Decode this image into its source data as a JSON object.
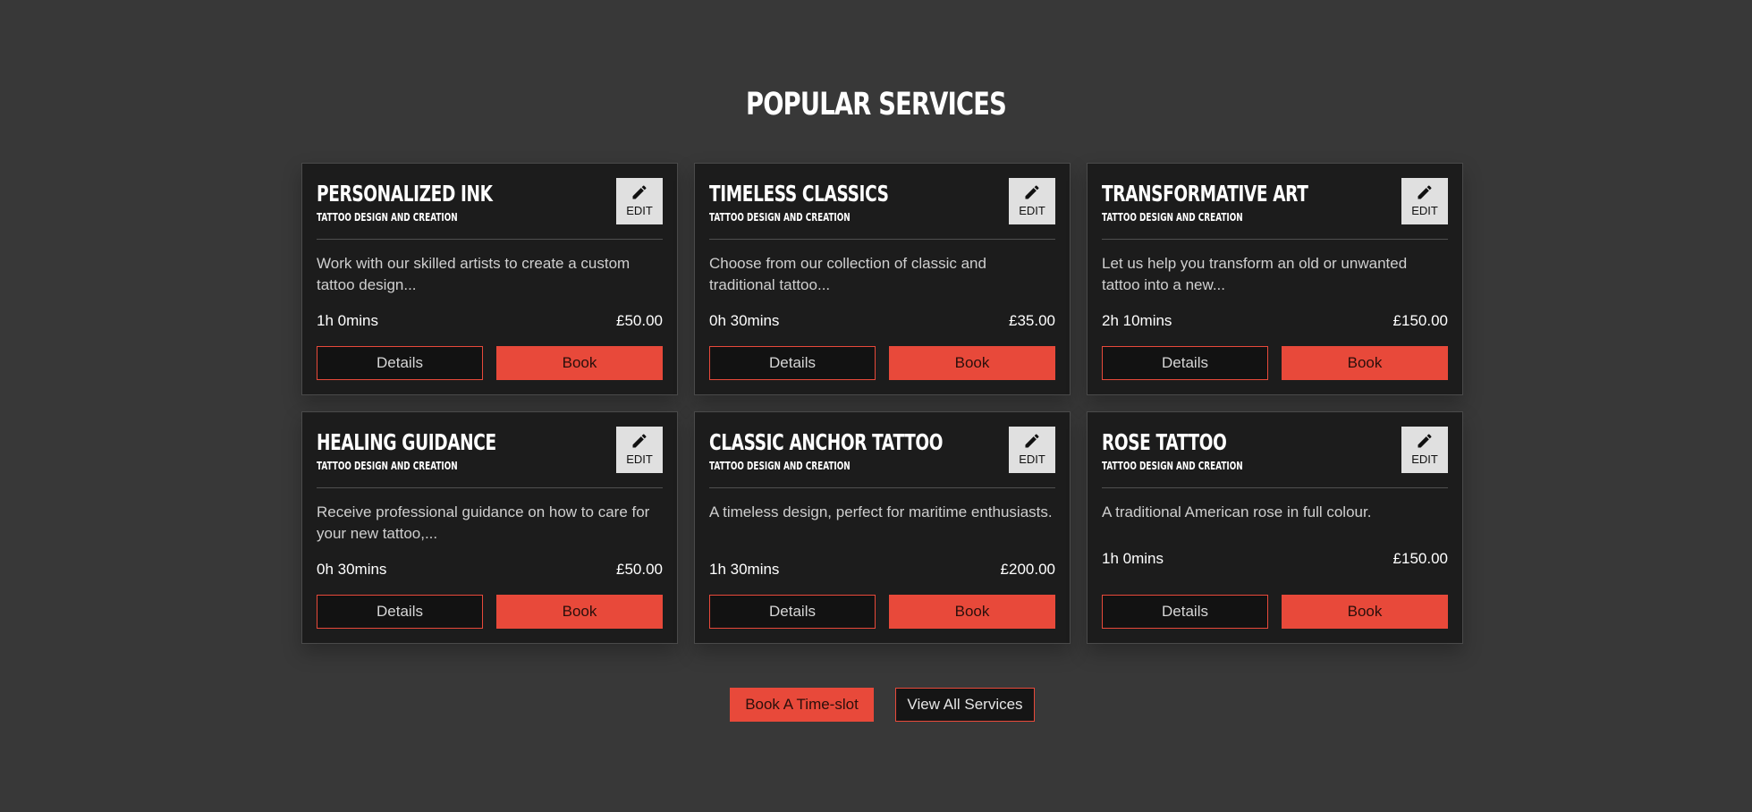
{
  "section": {
    "title": "POPULAR SERVICES"
  },
  "colors": {
    "background": "#383838",
    "card": "#1c1c1c",
    "accent": "#e8493a",
    "edit_button": "#e0e0e0"
  },
  "cards": [
    {
      "title": "PERSONALIZED INK",
      "subtitle": "TATTOO DESIGN AND CREATION",
      "edit_label": "EDIT",
      "edit_icon": "pencil-icon",
      "description": "Work with our skilled artists to create a custom tattoo design...",
      "duration": "1h 0mins",
      "price": "£50.00",
      "details_label": "Details",
      "book_label": "Book"
    },
    {
      "title": "TIMELESS CLASSICS",
      "subtitle": "TATTOO DESIGN AND CREATION",
      "edit_label": "EDIT",
      "edit_icon": "pencil-icon",
      "description": "Choose from our collection of classic and traditional tattoo...",
      "duration": "0h 30mins",
      "price": "£35.00",
      "details_label": "Details",
      "book_label": "Book"
    },
    {
      "title": "TRANSFORMATIVE ART",
      "subtitle": "TATTOO DESIGN AND CREATION",
      "edit_label": "EDIT",
      "edit_icon": "pencil-icon",
      "description": "Let us help you transform an old or unwanted tattoo into a new...",
      "duration": "2h 10mins",
      "price": "£150.00",
      "details_label": "Details",
      "book_label": "Book"
    },
    {
      "title": "HEALING GUIDANCE",
      "subtitle": "TATTOO DESIGN AND CREATION",
      "edit_label": "EDIT",
      "edit_icon": "pencil-icon",
      "description": "Receive professional guidance on how to care for your new tattoo,...",
      "duration": "0h 30mins",
      "price": "£50.00",
      "details_label": "Details",
      "book_label": "Book"
    },
    {
      "title": "CLASSIC ANCHOR TATTOO",
      "subtitle": "TATTOO DESIGN AND CREATION",
      "edit_label": "EDIT",
      "edit_icon": "pencil-icon",
      "description": "A timeless design, perfect for maritime enthusiasts.",
      "duration": "1h 30mins",
      "price": "£200.00",
      "details_label": "Details",
      "book_label": "Book"
    },
    {
      "title": "ROSE TATTOO",
      "subtitle": "TATTOO DESIGN AND CREATION",
      "edit_label": "EDIT",
      "edit_icon": "pencil-icon",
      "description": "A traditional American rose in full colour.",
      "duration": "1h 0mins",
      "price": "£150.00",
      "details_label": "Details",
      "book_label": "Book"
    }
  ],
  "footer": {
    "book_timeslot_label": "Book A Time-slot",
    "view_all_label": "View All Services"
  }
}
